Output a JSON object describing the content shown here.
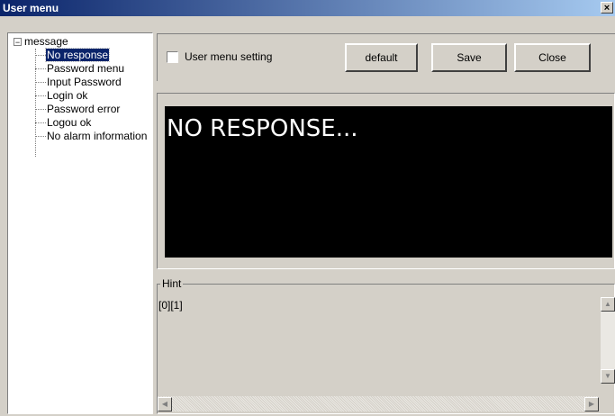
{
  "window": {
    "title": "User menu",
    "close": "×"
  },
  "tree": {
    "root": "message",
    "expander": "−",
    "items": [
      "No response",
      "Password menu",
      "Input Password",
      "Login ok",
      "Password error",
      "Logou ok",
      "No alarm information"
    ],
    "selected_index": 0
  },
  "toolbar": {
    "checkbox_label": "User menu setting",
    "checkbox_checked": false,
    "default_label": "default",
    "save_label": "Save",
    "close_label": "Close"
  },
  "display": {
    "text": "NO RESPONSE..."
  },
  "hint": {
    "label": "Hint",
    "text": "[0][1]"
  }
}
